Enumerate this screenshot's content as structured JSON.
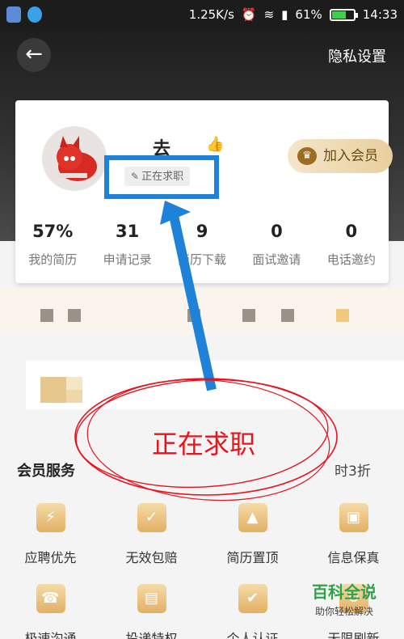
{
  "status_bar": {
    "speed": "1.25K/s",
    "battery": "61%",
    "battery_level": 0.61,
    "time": "14:33"
  },
  "header": {
    "back_icon": "←",
    "privacy_label": "隐私设置"
  },
  "profile": {
    "username": "去",
    "job_status": "正在求职",
    "member_button": "加入会员",
    "stats": [
      {
        "value": "57%",
        "label": "我的简历"
      },
      {
        "value": "31",
        "label": "申请记录"
      },
      {
        "value": "9",
        "label": "简历下载"
      },
      {
        "value": "0",
        "label": "面试邀请"
      },
      {
        "value": "0",
        "label": "电话邀约"
      }
    ]
  },
  "annotation": {
    "text": "正在求职",
    "highlight_color": "#1e82d8",
    "ink_color": "#e8131d"
  },
  "services": {
    "title": "会员服务",
    "discount": "时3折",
    "items": [
      {
        "label": "应聘优先",
        "icon": "document-bolt-icon"
      },
      {
        "label": "无效包赔",
        "icon": "badge-icon"
      },
      {
        "label": "简历置顶",
        "icon": "top-icon"
      },
      {
        "label": "信息保真",
        "icon": "id-card-icon"
      },
      {
        "label": "极速沟通",
        "icon": "phone-icon"
      },
      {
        "label": "投递特权",
        "icon": "resume-icon"
      },
      {
        "label": "个人认证",
        "icon": "verify-icon"
      },
      {
        "label": "无限刷新",
        "icon": "refresh-icon"
      }
    ]
  },
  "watermark": {
    "title": "百科全说",
    "subtitle": "助你轻松解决"
  }
}
